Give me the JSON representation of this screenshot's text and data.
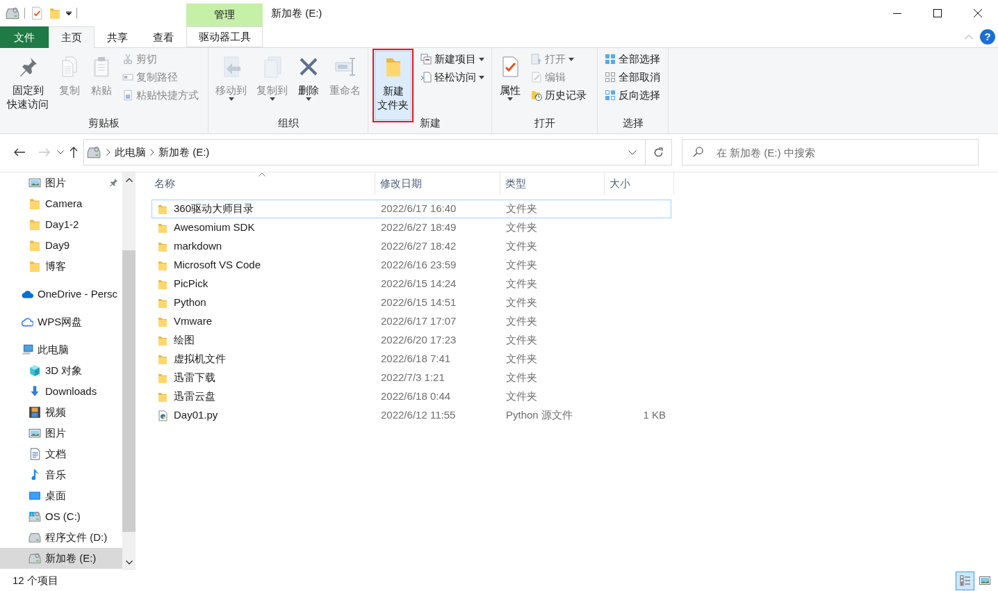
{
  "window": {
    "title": "新加卷 (E:)",
    "context_group": "管理",
    "help_label": "?"
  },
  "tabs": [
    {
      "label": "文件",
      "kind": "file",
      "selected": false
    },
    {
      "label": "主页",
      "kind": "normal",
      "selected": true
    },
    {
      "label": "共享",
      "kind": "normal",
      "selected": false
    },
    {
      "label": "查看",
      "kind": "normal",
      "selected": false
    },
    {
      "label": "驱动器工具",
      "kind": "contextual",
      "selected": false
    }
  ],
  "ribbon": {
    "groups": [
      {
        "label": "剪贴板",
        "items": [
          {
            "kind": "big",
            "lines": [
              "固定到",
              "快速访问"
            ],
            "disabled": false,
            "dropdown": false,
            "highlighted": false,
            "framed": false
          },
          {
            "kind": "big",
            "lines": [
              "复制"
            ],
            "disabled": true,
            "dropdown": false,
            "highlighted": false,
            "framed": false
          },
          {
            "kind": "big",
            "lines": [
              "粘贴"
            ],
            "disabled": true,
            "dropdown": false,
            "highlighted": false,
            "framed": false
          },
          {
            "kind": "small",
            "lines": [
              "剪切"
            ],
            "disabled": true,
            "dropdown": false,
            "highlighted": false,
            "framed": false
          },
          {
            "kind": "small",
            "lines": [
              "复制路径"
            ],
            "disabled": true,
            "dropdown": false,
            "highlighted": false,
            "framed": false
          },
          {
            "kind": "small",
            "lines": [
              "粘贴快捷方式"
            ],
            "disabled": true,
            "dropdown": false,
            "highlighted": false,
            "framed": false
          }
        ]
      },
      {
        "label": "组织",
        "items": [
          {
            "kind": "big",
            "lines": [
              "移动到"
            ],
            "disabled": true,
            "dropdown": true,
            "highlighted": false,
            "framed": false
          },
          {
            "kind": "big",
            "lines": [
              "复制到"
            ],
            "disabled": true,
            "dropdown": true,
            "highlighted": false,
            "framed": false
          },
          {
            "kind": "big",
            "lines": [
              "删除"
            ],
            "disabled": false,
            "dropdown": true,
            "highlighted": false,
            "framed": false
          },
          {
            "kind": "big",
            "lines": [
              "重命名"
            ],
            "disabled": true,
            "dropdown": false,
            "highlighted": false,
            "framed": false
          }
        ]
      },
      {
        "label": "新建",
        "items": [
          {
            "kind": "big",
            "lines": [
              "新建",
              "文件夹"
            ],
            "disabled": false,
            "dropdown": false,
            "highlighted": true,
            "framed": true
          },
          {
            "kind": "small",
            "lines": [
              "新建项目"
            ],
            "disabled": false,
            "dropdown": true,
            "highlighted": false,
            "framed": false
          },
          {
            "kind": "small",
            "lines": [
              "轻松访问"
            ],
            "disabled": false,
            "dropdown": true,
            "highlighted": false,
            "framed": false
          }
        ]
      },
      {
        "label": "打开",
        "items": [
          {
            "kind": "big",
            "lines": [
              "属性"
            ],
            "disabled": false,
            "dropdown": true,
            "highlighted": false,
            "framed": false
          },
          {
            "kind": "small",
            "lines": [
              "打开"
            ],
            "disabled": true,
            "dropdown": true,
            "highlighted": false,
            "framed": false
          },
          {
            "kind": "small",
            "lines": [
              "编辑"
            ],
            "disabled": true,
            "dropdown": false,
            "highlighted": false,
            "framed": false
          },
          {
            "kind": "small",
            "lines": [
              "历史记录"
            ],
            "disabled": false,
            "dropdown": false,
            "highlighted": false,
            "framed": false
          }
        ]
      },
      {
        "label": "选择",
        "items": [
          {
            "kind": "small",
            "lines": [
              "全部选择"
            ],
            "disabled": false,
            "dropdown": false,
            "highlighted": false,
            "framed": false
          },
          {
            "kind": "small",
            "lines": [
              "全部取消"
            ],
            "disabled": false,
            "dropdown": false,
            "highlighted": false,
            "framed": false
          },
          {
            "kind": "small",
            "lines": [
              "反向选择"
            ],
            "disabled": false,
            "dropdown": false,
            "highlighted": false,
            "framed": false
          }
        ]
      }
    ]
  },
  "history": {
    "back_enabled": true,
    "forward_enabled": false
  },
  "address": {
    "breadcrumbs": [
      "此电脑",
      "新加卷 (E:)"
    ]
  },
  "search": {
    "placeholder": "在 新加卷 (E:) 中搜索"
  },
  "nav": {
    "quick_access": [
      {
        "label": "图片",
        "kind": "picture",
        "pinned": true,
        "selected": false
      },
      {
        "label": "Camera",
        "kind": "folder",
        "pinned": false,
        "selected": false
      },
      {
        "label": "Day1-2",
        "kind": "folder",
        "pinned": false,
        "selected": false
      },
      {
        "label": "Day9",
        "kind": "folder",
        "pinned": false,
        "selected": false
      },
      {
        "label": "博客",
        "kind": "folder",
        "pinned": false,
        "selected": false
      }
    ],
    "roots": [
      {
        "label": "OneDrive - Persc",
        "kind": "cloud",
        "selected": false
      },
      {
        "label": "WPS网盘",
        "kind": "wps",
        "selected": false
      },
      {
        "label": "此电脑",
        "kind": "pc",
        "selected": false,
        "children": [
          {
            "label": "3D 对象",
            "kind": "cube",
            "selected": false
          },
          {
            "label": "Downloads",
            "kind": "download",
            "selected": false
          },
          {
            "label": "视频",
            "kind": "video",
            "selected": false
          },
          {
            "label": "图片",
            "kind": "picture",
            "selected": false
          },
          {
            "label": "文档",
            "kind": "document",
            "selected": false
          },
          {
            "label": "音乐",
            "kind": "music",
            "selected": false
          },
          {
            "label": "桌面",
            "kind": "desktop",
            "selected": false
          },
          {
            "label": "OS (C:)",
            "kind": "drive_os",
            "selected": false
          },
          {
            "label": "程序文件 (D:)",
            "kind": "drive",
            "selected": false
          },
          {
            "label": "新加卷 (E:)",
            "kind": "drive_usb",
            "selected": true
          }
        ]
      }
    ]
  },
  "table": {
    "columns": [
      {
        "label": "名称",
        "sorted": true
      },
      {
        "label": "修改日期",
        "sorted": false
      },
      {
        "label": "类型",
        "sorted": false
      },
      {
        "label": "大小",
        "sorted": false
      }
    ],
    "rows": [
      {
        "kind": "folder",
        "name": "360驱动大师目录",
        "date": "2022/6/17 16:40",
        "type": "文件夹",
        "focused": true
      },
      {
        "kind": "folder",
        "name": "Awesomium SDK",
        "date": "2022/6/27 18:49",
        "type": "文件夹",
        "focused": false
      },
      {
        "kind": "folder",
        "name": "markdown",
        "date": "2022/6/27 18:42",
        "type": "文件夹",
        "focused": false
      },
      {
        "kind": "folder",
        "name": "Microsoft VS Code",
        "date": "2022/6/16 23:59",
        "type": "文件夹",
        "focused": false
      },
      {
        "kind": "folder",
        "name": "PicPick",
        "date": "2022/6/15 14:24",
        "type": "文件夹",
        "focused": false
      },
      {
        "kind": "folder",
        "name": "Python",
        "date": "2022/6/15 14:51",
        "type": "文件夹",
        "focused": false
      },
      {
        "kind": "folder",
        "name": "Vmware",
        "date": "2022/6/17 17:07",
        "type": "文件夹",
        "focused": false
      },
      {
        "kind": "folder",
        "name": "绘图",
        "date": "2022/6/20 17:23",
        "type": "文件夹",
        "focused": false
      },
      {
        "kind": "folder",
        "name": "虚拟机文件",
        "date": "2022/6/18 7:41",
        "type": "文件夹",
        "focused": false
      },
      {
        "kind": "folder",
        "name": "迅雷下载",
        "date": "2022/7/3 1:21",
        "type": "文件夹",
        "focused": false
      },
      {
        "kind": "folder",
        "name": "迅雷云盘",
        "date": "2022/6/18 0:44",
        "type": "文件夹",
        "focused": false
      },
      {
        "kind": "python",
        "name": "Day01.py",
        "date": "2022/6/12 11:55",
        "type": "Python 源文件",
        "size": "1 KB",
        "focused": false
      }
    ]
  },
  "status_bar": {
    "count": "12 个项目",
    "views": [
      {
        "kind": "details",
        "selected": true
      },
      {
        "kind": "large_icons",
        "selected": false
      }
    ]
  }
}
